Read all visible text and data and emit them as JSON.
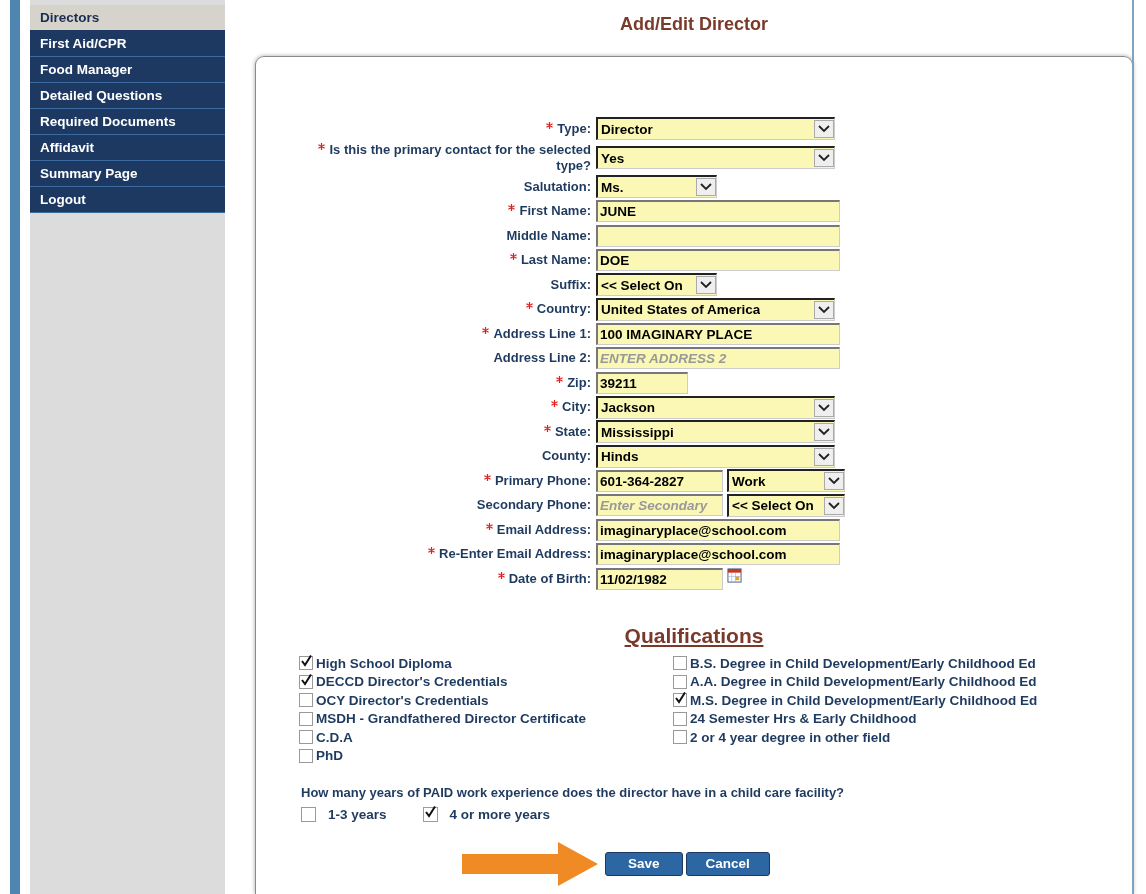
{
  "sidebar": {
    "items": [
      {
        "label": "Directors",
        "selected": true
      },
      {
        "label": "First Aid/CPR",
        "selected": false
      },
      {
        "label": "Food Manager",
        "selected": false
      },
      {
        "label": "Detailed Questions",
        "selected": false
      },
      {
        "label": "Required Documents",
        "selected": false
      },
      {
        "label": "Affidavit",
        "selected": false
      },
      {
        "label": "Summary Page",
        "selected": false
      },
      {
        "label": "Logout",
        "selected": false
      }
    ]
  },
  "page_title": "Add/Edit Director",
  "form": {
    "fields": [
      {
        "label": "Type:",
        "required": true,
        "kind": "select",
        "value": "Director"
      },
      {
        "label": "Is this the primary contact for the selected type?",
        "required": true,
        "kind": "select",
        "value": "Yes"
      },
      {
        "label": "Salutation:",
        "required": false,
        "kind": "select-small",
        "value": "Ms."
      },
      {
        "label": "First Name:",
        "required": true,
        "kind": "text",
        "value": "JUNE"
      },
      {
        "label": "Middle Name:",
        "required": false,
        "kind": "text"
      },
      {
        "label": "Last Name:",
        "required": true,
        "kind": "text",
        "value": "DOE"
      },
      {
        "label": "Suffix:",
        "required": false,
        "kind": "select-small",
        "value": "<< Select On"
      },
      {
        "label": "Country:",
        "required": true,
        "kind": "select",
        "value": "United States of America"
      },
      {
        "label": "Address Line 1:",
        "required": true,
        "kind": "text",
        "value": "100 IMAGINARY PLACE"
      },
      {
        "label": "Address Line 2:",
        "required": false,
        "kind": "text",
        "placeholder": "ENTER ADDRESS 2"
      },
      {
        "label": "Zip:",
        "required": true,
        "kind": "text-small",
        "value": "39211"
      },
      {
        "label": "City:",
        "required": true,
        "kind": "select",
        "value": "Jackson"
      },
      {
        "label": "State:",
        "required": true,
        "kind": "select",
        "value": "Mississippi"
      },
      {
        "label": "County:",
        "required": false,
        "kind": "select",
        "value": "Hinds"
      },
      {
        "label": "Primary Phone:",
        "required": true,
        "kind": "phone",
        "value": "601-364-2827",
        "type_value": "Work"
      },
      {
        "label": "Secondary Phone:",
        "required": false,
        "kind": "phone",
        "placeholder": "Enter Secondary",
        "type_value": "<< Select On"
      },
      {
        "label": "Email Address:",
        "required": true,
        "kind": "text",
        "value": "imaginaryplace@school.com"
      },
      {
        "label": "Re-Enter Email Address:",
        "required": true,
        "kind": "text",
        "value": "imaginaryplace@school.com"
      },
      {
        "label": "Date of Birth:",
        "required": true,
        "kind": "date",
        "value": "11/02/1982"
      }
    ]
  },
  "qualifications": {
    "title": "Qualifications",
    "columns": [
      [
        {
          "label": "High School Diploma",
          "checked": true
        },
        {
          "label": "DECCD Director's Credentials",
          "checked": true
        },
        {
          "label": "OCY Director's Credentials",
          "checked": false
        },
        {
          "label": "MSDH - Grandfathered Director Certificate",
          "checked": false
        },
        {
          "label": "C.D.A",
          "checked": false
        },
        {
          "label": "PhD",
          "checked": false
        }
      ],
      [
        {
          "label": "B.S. Degree in Child Development/Early Childhood Ed",
          "checked": false
        },
        {
          "label": "A.A. Degree in Child Development/Early Childhood Ed",
          "checked": false
        },
        {
          "label": "M.S. Degree in Child Development/Early Childhood Ed",
          "checked": true
        },
        {
          "label": "24 Semester Hrs & Early Childhood",
          "checked": false
        },
        {
          "label": "2 or 4 year degree in other field",
          "checked": false
        }
      ]
    ]
  },
  "experience": {
    "question": "How many years of PAID work experience does the director have in a child care facility?",
    "options": [
      {
        "label": "1-3 years",
        "checked": false
      },
      {
        "label": "4 or more years",
        "checked": true
      }
    ]
  },
  "buttons": [
    {
      "label": "Save"
    },
    {
      "label": "Cancel"
    }
  ]
}
